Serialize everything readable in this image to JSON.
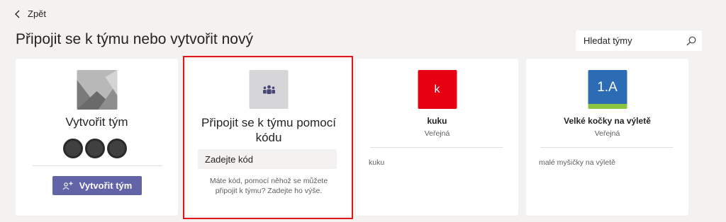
{
  "nav": {
    "back_label": "Zpět"
  },
  "page": {
    "title": "Připojit se k týmu nebo vytvořit nový"
  },
  "search": {
    "placeholder": "Hledat týmy",
    "value": ""
  },
  "create_card": {
    "title": "Vytvořit tým",
    "button_label": "Vytvořit tým",
    "icon": "create-team-icon"
  },
  "join_card": {
    "title": "Připojit se k týmu pomocí kódu",
    "input_placeholder": "Zadejte kód",
    "help_text": "Máte kód, pomocí něhož se můžete připojit k týmu? Zadejte ho výše.",
    "icon": "teams-people-icon"
  },
  "teams": [
    {
      "tile_text": "k",
      "tile_color": "#e60012",
      "name": "kuku",
      "type": "Veřejná",
      "description": "kuku"
    },
    {
      "tile_text": "1.A",
      "tile_color": "#2b6cb4",
      "tile_stripe_color": "#8cc63e",
      "name": "Velké kočky na výletě",
      "type": "Veřejná",
      "description": "malé myšičky na výletě"
    }
  ],
  "colors": {
    "accent": "#6264a7",
    "highlight_border": "#e0161b",
    "background": "#f3f2f1"
  }
}
